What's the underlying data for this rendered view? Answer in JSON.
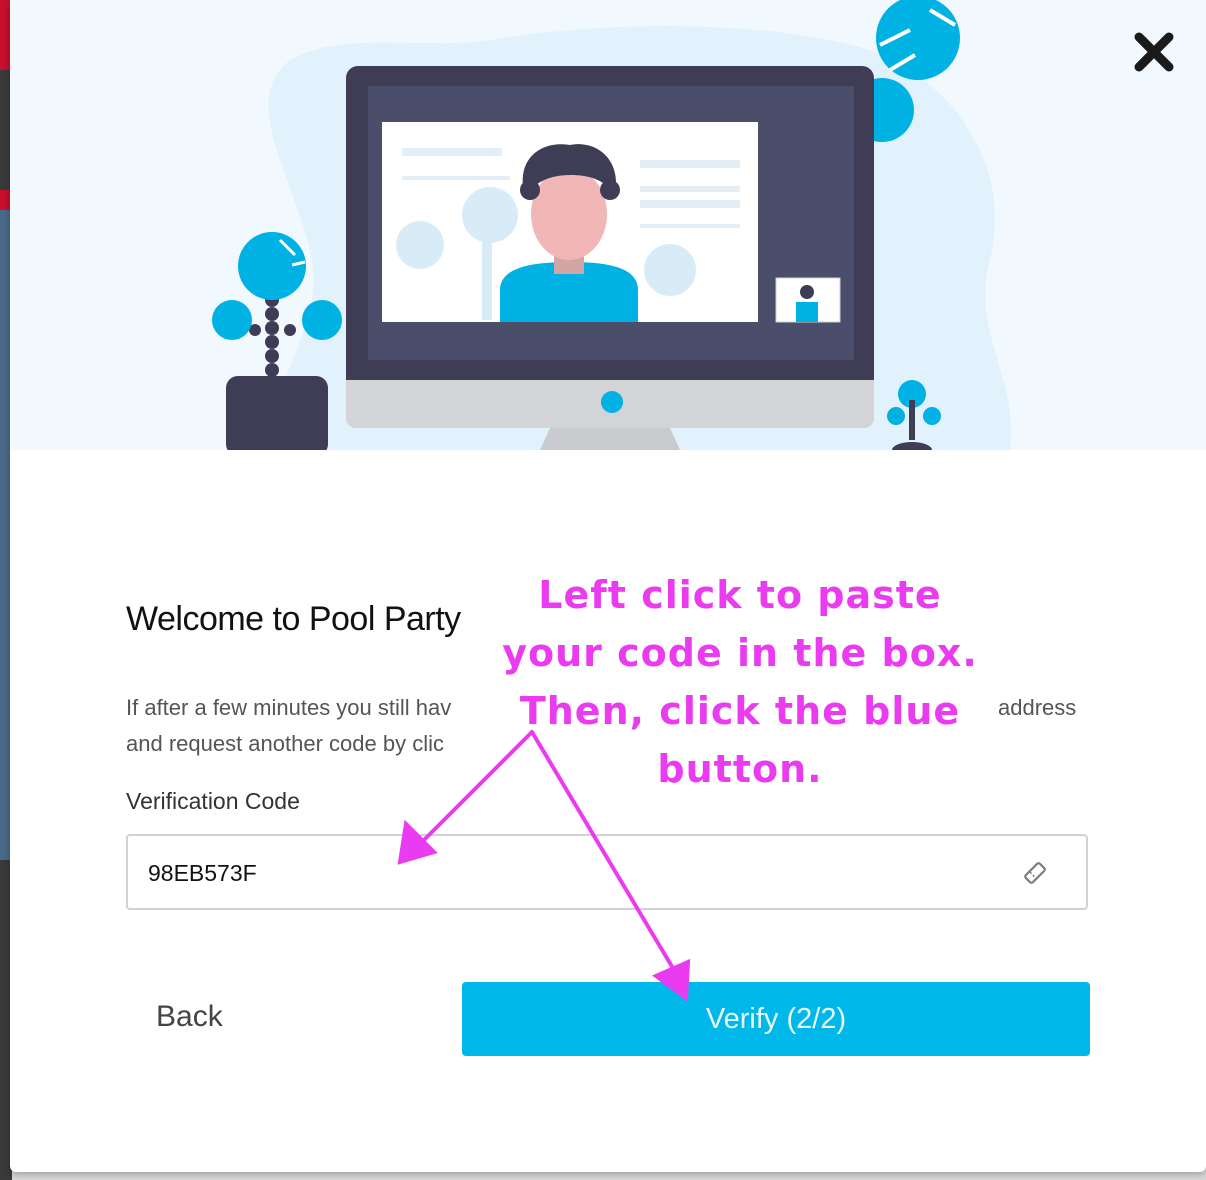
{
  "dialog": {
    "title": "Welcome to Pool Party",
    "description_line1": "If after a few minutes you still hav",
    "description_line2": "and request another code by clic",
    "description_right": "address",
    "field_label": "Verification Code",
    "code_value": "98EB573F",
    "back_label": "Back",
    "verify_label": "Verify (2/2)"
  },
  "annotation": {
    "lines": [
      "Left click to paste",
      "your code in the box.",
      "Then, click the blue",
      "button."
    ],
    "color": "#ea3bf0"
  },
  "colors": {
    "primary_button": "#00b7e9",
    "hero_background": "#f1f9fe",
    "illustration_accent": "#00b1e3",
    "monitor_dark": "#3f3d56"
  },
  "icons": {
    "close": "close-icon",
    "ticket": "ticket-icon"
  }
}
